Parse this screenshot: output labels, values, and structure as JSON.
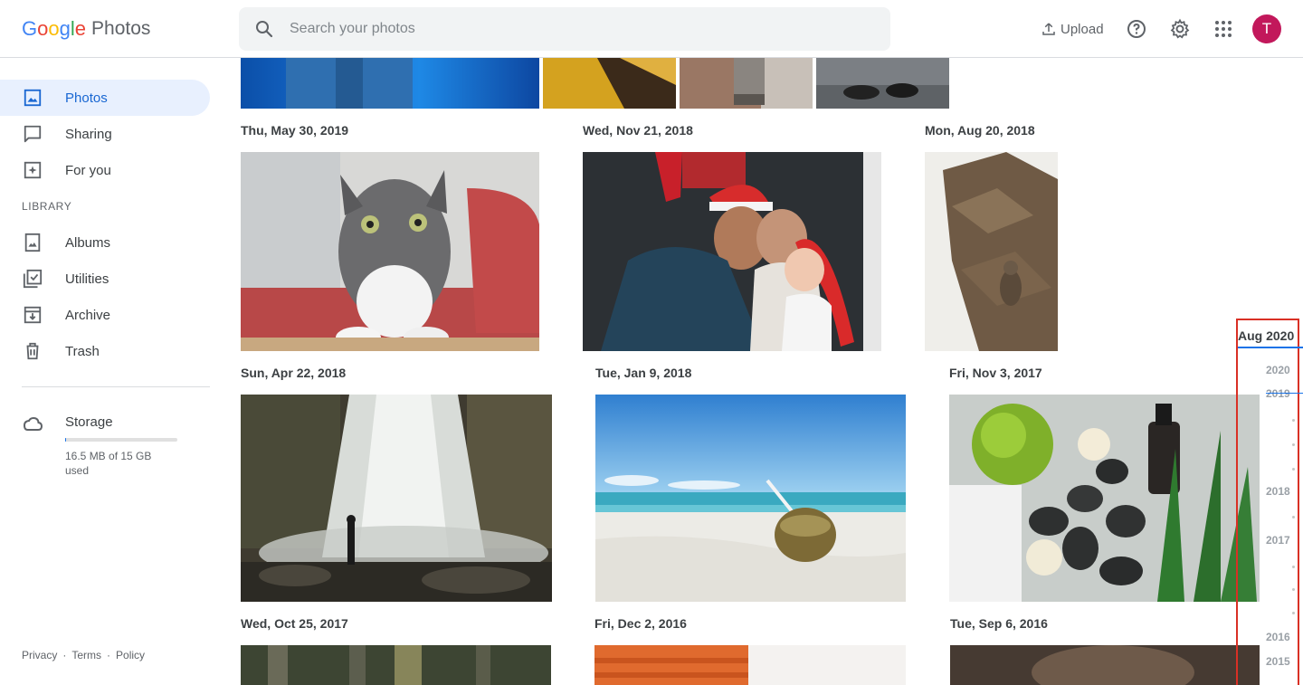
{
  "app": {
    "logo_letters": [
      "G",
      "o",
      "o",
      "g",
      "l",
      "e"
    ],
    "product": "Photos"
  },
  "search": {
    "placeholder": "Search your photos"
  },
  "header": {
    "upload_label": "Upload",
    "avatar_letter": "T"
  },
  "sidebar": {
    "items": [
      {
        "label": "Photos",
        "icon": "photo-icon",
        "active": true
      },
      {
        "label": "Sharing",
        "icon": "chat-icon"
      },
      {
        "label": "For you",
        "icon": "for-you-icon"
      },
      {
        "label": "Albums",
        "icon": "album-icon"
      },
      {
        "label": "Utilities",
        "icon": "utilities-icon"
      },
      {
        "label": "Archive",
        "icon": "archive-icon"
      },
      {
        "label": "Trash",
        "icon": "trash-icon"
      }
    ],
    "library_label": "LIBRARY",
    "storage": {
      "label": "Storage",
      "used_text": "16.5 MB of 15 GB used",
      "used_fraction": 0.0011
    },
    "footer": [
      "Privacy",
      "·",
      "Terms",
      "·",
      "Policy"
    ]
  },
  "photos": {
    "dates": [
      "Thu, May 30, 2019",
      "Wed, Nov 21, 2018",
      "Mon, Aug 20, 2018",
      "Sun, Apr 22, 2018",
      "Tue, Jan 9, 2018",
      "Fri, Nov 3, 2017",
      "Wed, Oct 25, 2017",
      "Fri, Dec 2, 2016",
      "Tue, Sep 6, 2016"
    ]
  },
  "scrubber": {
    "current": "Aug 2020",
    "years": [
      "2020",
      "2019",
      "2018",
      "2017",
      "2016",
      "2015"
    ]
  },
  "colors": {
    "accent": "#1a73e8",
    "active_bg": "#e8f0fe",
    "avatar": "#c2185b",
    "highlight_box": "#d93025"
  }
}
